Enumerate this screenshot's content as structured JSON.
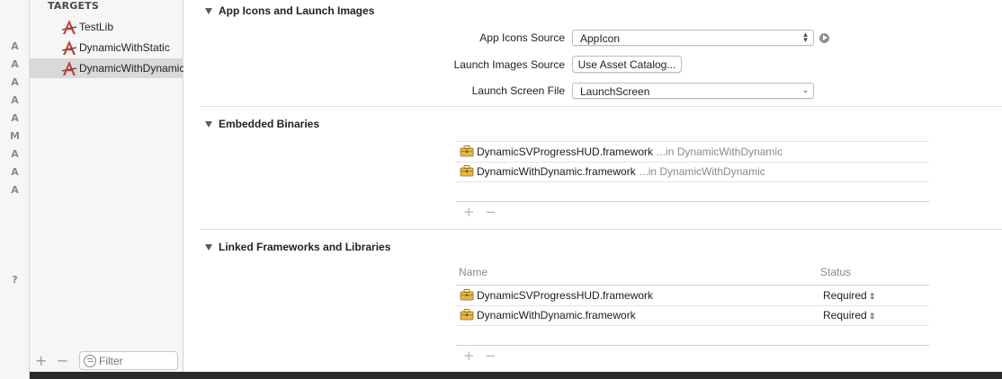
{
  "gutter": {
    "statuses": [
      "A",
      "A",
      "A",
      "A",
      "A",
      "M",
      "A",
      "A",
      "A",
      "?"
    ]
  },
  "sidebar": {
    "header": "TARGETS",
    "targets": [
      {
        "label": "TestLib",
        "icon": "application-target-icon"
      },
      {
        "label": "DynamicWithStatic",
        "icon": "application-target-icon"
      },
      {
        "label": "DynamicWithDynamic",
        "icon": "application-target-icon",
        "selected": true
      }
    ],
    "filter_placeholder": "Filter",
    "add_label": "+",
    "remove_label": "−"
  },
  "app_icons": {
    "title": "App Icons and Launch Images",
    "icons_source_label": "App Icons Source",
    "icons_source_value": "AppIcon",
    "launch_images_label": "Launch Images Source",
    "launch_images_button": "Use Asset Catalog...",
    "launch_screen_label": "Launch Screen File",
    "launch_screen_value": "LaunchScreen"
  },
  "embedded": {
    "title": "Embedded Binaries",
    "rows": [
      {
        "name": "DynamicSVProgressHUD.framework",
        "location": "...in DynamicWithDynamic"
      },
      {
        "name": "DynamicWithDynamic.framework",
        "location": "...in DynamicWithDynamic"
      }
    ],
    "add_label": "+",
    "remove_label": "−"
  },
  "linked": {
    "title": "Linked Frameworks and Libraries",
    "col_name": "Name",
    "col_status": "Status",
    "rows": [
      {
        "name": "DynamicSVProgressHUD.framework",
        "status": "Required"
      },
      {
        "name": "DynamicWithDynamic.framework",
        "status": "Required"
      }
    ],
    "add_label": "+",
    "remove_label": "−"
  },
  "colors": {
    "selected_row": "#d9d9d9",
    "framework_icon": "#e8b640",
    "target_icon": "#c9412f"
  }
}
